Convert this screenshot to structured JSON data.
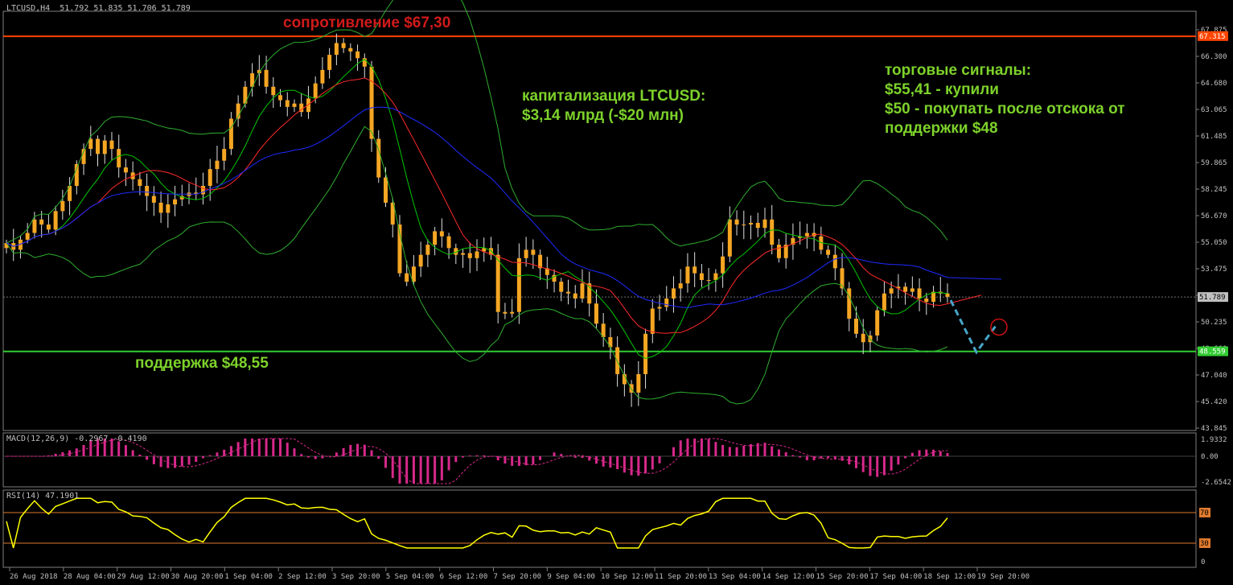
{
  "symbol_header": "LTCUSD,H4  51.792 51.835 51.706 51.789",
  "macd_header": "MACD(12,26,9) -0.2967 -0.4190",
  "rsi_header": "RSI(14) 47.1901",
  "annotations": {
    "resistance": "сопротивление $67,30",
    "capitalization": "капитализация LTCUSD:\n$3,14 млрд (-$20 млн)",
    "signals": "торговые сигналы:\n$55,41 - купили\n$50 - покупать после отскока от\nподдержки $48",
    "support": "поддержка $48,55"
  },
  "price_axis": {
    "ticks": [
      "67.875",
      "66.300",
      "64.680",
      "63.065",
      "61.485",
      "59.865",
      "58.245",
      "56.670",
      "55.050",
      "53.475",
      "51.855",
      "50.235",
      "48.660",
      "47.040",
      "45.420",
      "43.845"
    ],
    "markers": [
      {
        "label": "67.315",
        "value": 67.315,
        "color": "#ff4500"
      },
      {
        "label": "51.789",
        "value": 51.789,
        "color": "#c0c0c0"
      },
      {
        "label": "48.559",
        "value": 48.559,
        "color": "#32cd32"
      }
    ]
  },
  "macd_axis": {
    "ticks": [
      "1.9332",
      "0.00",
      "-2.6542"
    ]
  },
  "rsi_axis": {
    "ticks": [
      "70",
      "30",
      "0"
    ]
  },
  "time_axis": {
    "ticks": [
      "26 Aug 2018",
      "28 Aug 04:00",
      "29 Aug 12:00",
      "30 Aug 20:00",
      "1 Sep 04:00",
      "2 Sep 12:00",
      "3 Sep 20:00",
      "5 Sep 04:00",
      "6 Sep 12:00",
      "7 Sep 20:00",
      "9 Sep 04:00",
      "10 Sep 12:00",
      "11 Sep 20:00",
      "13 Sep 04:00",
      "14 Sep 12:00",
      "15 Sep 20:00",
      "17 Sep 04:00",
      "18 Sep 12:00",
      "19 Sep 20:00"
    ]
  },
  "colors": {
    "bull_candle": "#f5a623",
    "bear_candle": "#f5a623",
    "wick": "#e0e0e0",
    "ma_fast": "#ff2a2a",
    "ma_mid": "#00c800",
    "ma_slow": "#1e2bff",
    "bollinger": "#2fae2f",
    "resistance": "#ff4500",
    "support": "#32cd32",
    "macd_hist": "#d6298a",
    "macd_signal": "#d6298a",
    "rsi": "#ffff00",
    "rsi_levels": "#e07a2e",
    "forecast": "#47a6c9"
  },
  "chart_data": {
    "type": "candlestick",
    "symbol": "LTCUSD",
    "timeframe": "H4",
    "resistance": 67.3,
    "support": 48.55,
    "last_price": 51.789,
    "ylim": [
      43.845,
      68.6
    ],
    "close": [
      55.0,
      54.6,
      55.2,
      55.6,
      56.4,
      56.1,
      55.8,
      56.9,
      57.5,
      58.4,
      59.7,
      60.6,
      61.2,
      60.3,
      61.1,
      60.6,
      59.5,
      59.2,
      58.8,
      58.4,
      57.8,
      57.4,
      56.8,
      57.3,
      57.6,
      57.8,
      58.0,
      57.9,
      58.4,
      59.4,
      59.9,
      60.6,
      62.4,
      63.3,
      64.3,
      65.1,
      65.3,
      64.3,
      63.8,
      63.5,
      63.1,
      63.3,
      62.8,
      63.6,
      64.5,
      65.3,
      66.2,
      66.9,
      66.6,
      66.4,
      66.0,
      65.5,
      61.2,
      58.9,
      57.4,
      56.1,
      53.2,
      52.7,
      53.6,
      54.3,
      54.9,
      55.7,
      55.4,
      54.7,
      54.3,
      54.4,
      54.1,
      54.5,
      54.7,
      54.3,
      50.9,
      50.8,
      50.9,
      54.1,
      54.6,
      54.3,
      53.5,
      53.1,
      52.7,
      52.1,
      52.0,
      51.7,
      52.6,
      51.4,
      50.2,
      49.4,
      48.8,
      47.2,
      46.6,
      46.1,
      47.2,
      49.6,
      51.1,
      51.2,
      51.7,
      52.3,
      52.6,
      53.6,
      53.2,
      52.8,
      52.8,
      53.2,
      54.2,
      56.4,
      56.1,
      56.1,
      56.2,
      55.9,
      56.4,
      54.9,
      54.1,
      54.9,
      55.3,
      55.4,
      55.6,
      55.4,
      54.6,
      54.3,
      53.5,
      52.3,
      50.5,
      49.6,
      49.1,
      49.5,
      51.0,
      52.0,
      52.3,
      52.4,
      52.1,
      52.3,
      51.7,
      51.5,
      52.1,
      52.0,
      51.8
    ]
  }
}
